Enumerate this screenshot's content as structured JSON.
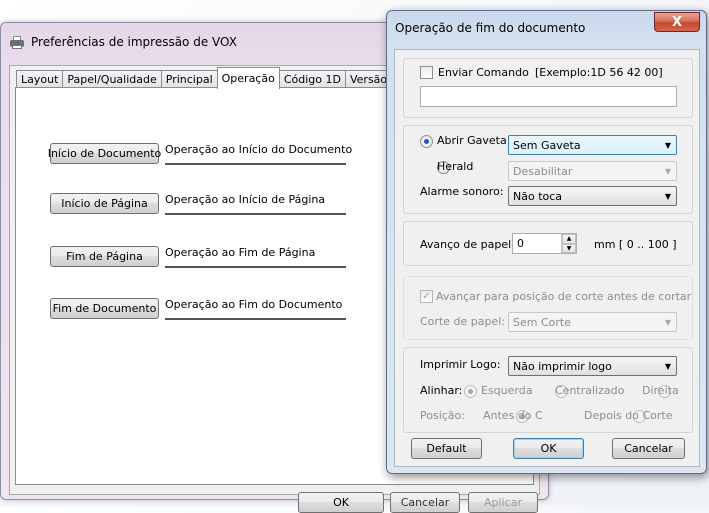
{
  "back_window": {
    "title": "Preferências de impressão de VOX",
    "tabs": [
      "Layout",
      "Papel/Qualidade",
      "Principal",
      "Operação",
      "Código 1D",
      "Versão"
    ],
    "active_tab": "Operação",
    "operations": [
      {
        "button": "Início de Documento",
        "text": "Operação ao Início do Documento"
      },
      {
        "button": "Início de Página",
        "text": "Operação ao Início de Página"
      },
      {
        "button": "Fim de Página",
        "text": "Operação ao Fim de Página"
      },
      {
        "button": "Fim de Documento",
        "text": "Operação ao Fim do Documento"
      }
    ],
    "ok_label": "OK",
    "cancel_label": "Cancelar",
    "apply_label": "Aplicar"
  },
  "dialog": {
    "title": "Operação de fim do documento",
    "close_label": "X",
    "send_command": {
      "label": "Enviar Comando",
      "example": "[Exemplo:1D 56 42 00]",
      "value": ""
    },
    "drawer": {
      "open_drawer_label": "Abrir Gaveta",
      "open_drawer_value": "Sem Gaveta",
      "herald_label": "Herald",
      "herald_value": "Desabilitar",
      "alarm_label": "Alarme sonoro:",
      "alarm_value": "Não toca"
    },
    "feed": {
      "label": "Avanço de papel:",
      "value": "0",
      "range": "mm [ 0 .. 100 ]"
    },
    "cut": {
      "advance_label": "Avançar para posição de corte antes de cortar",
      "paper_cut_label": "Corte de papel:",
      "paper_cut_value": "Sem Corte"
    },
    "logo": {
      "print_label": "Imprimir Logo:",
      "print_value": "Não imprimir logo",
      "align_label": "Alinhar:",
      "align_left": "Esquerda",
      "align_center": "Centralizado",
      "align_right": "Direita",
      "position_label": "Posição:",
      "position_before": "Antes do Coi",
      "position_after": "Depois do Corte"
    },
    "default_label": "Default",
    "ok_label": "OK",
    "cancel_label": "Cancelar"
  }
}
